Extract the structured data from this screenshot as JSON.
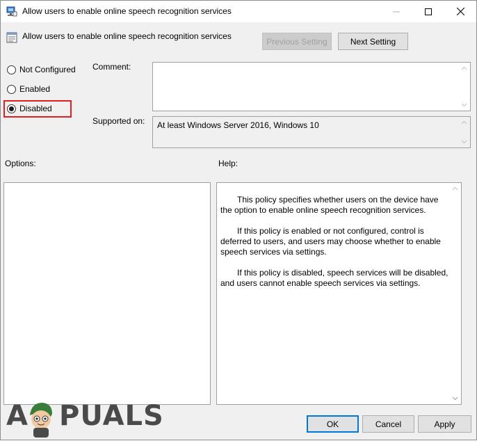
{
  "window": {
    "title": "Allow users to enable online speech recognition services",
    "controls": [
      "minimize-icon",
      "maximize-icon",
      "close-icon"
    ]
  },
  "header": {
    "policy_title": "Allow users to enable online speech recognition services",
    "previous_label": "Previous Setting",
    "next_label": "Next Setting"
  },
  "state": {
    "options": [
      {
        "label": "Not Configured",
        "selected": false
      },
      {
        "label": "Enabled",
        "selected": false
      },
      {
        "label": "Disabled",
        "selected": true
      }
    ],
    "highlight_color": "#e02020"
  },
  "comment": {
    "label": "Comment:",
    "value": ""
  },
  "supported": {
    "label": "Supported on:",
    "value": "At least Windows Server 2016, Windows 10"
  },
  "options_label": "Options:",
  "help": {
    "label": "Help:",
    "paragraphs": [
      "This policy specifies whether users on the device have the option to enable online speech recognition services.",
      "If this policy is enabled or not configured, control is deferred to users, and users may choose whether to enable speech services via settings.",
      "If this policy is disabled, speech services will be disabled, and users cannot enable speech services via settings."
    ]
  },
  "footer": {
    "ok_label": "OK",
    "cancel_label": "Cancel",
    "apply_label": "Apply"
  },
  "watermark": {
    "text_left": "A",
    "text_right": "PUALS"
  },
  "colors": {
    "accent": "#0078d7",
    "dialog_bg": "#f0f0f0",
    "disabled_text": "#a0a0a0"
  }
}
